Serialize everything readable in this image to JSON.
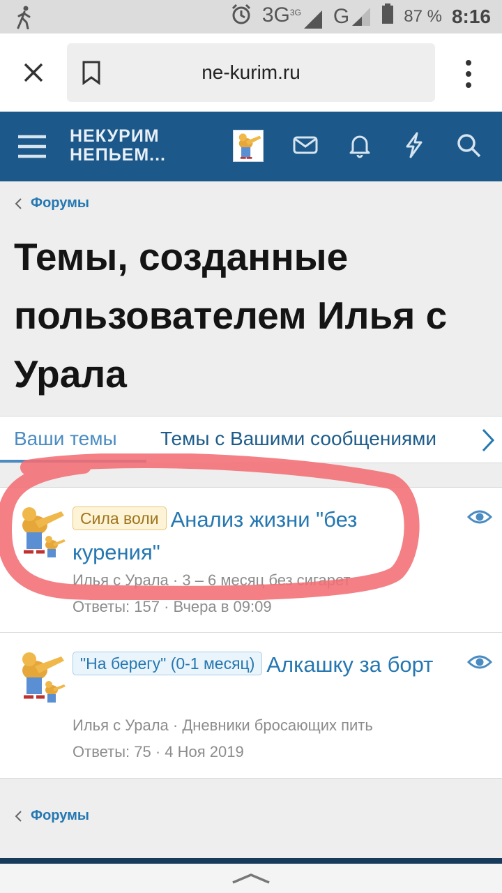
{
  "status_bar": {
    "network1": "3G",
    "network1_sup": "3G",
    "network2": "G",
    "battery": "87 %",
    "time": "8:16"
  },
  "browser": {
    "url": "ne-kurim.ru"
  },
  "site": {
    "logo_line1": "НЕКУРИМ",
    "logo_line2": "НЕПЬЕМ..."
  },
  "breadcrumb": {
    "label": "Форумы"
  },
  "page_title": "Темы, созданные пользователем Илья с Урала",
  "tabs": [
    {
      "label": "Ваши темы",
      "active": true
    },
    {
      "label": "Темы с Вашими сообщениями",
      "active": false
    }
  ],
  "threads": [
    {
      "prefix": "Сила воли",
      "prefix_style": "gold",
      "title": "Анализ жизни \"без курения\"",
      "author": "Илья с Урала",
      "forum": "3 – 6 месяц без сигарет",
      "replies_label": "Ответы: 157",
      "last_post": "Вчера в 09:09"
    },
    {
      "prefix": "\"На берегу\" (0-1 месяц)",
      "prefix_style": "blue",
      "title": "Алкашку за борт",
      "author": "Илья с Урала",
      "forum": "Дневники бросающих пить",
      "replies_label": "Ответы: 75",
      "last_post": "4 Ноя 2019"
    }
  ],
  "footer_breadcrumb": {
    "label": "Форумы"
  },
  "colors": {
    "header_bg": "#1c5889",
    "link": "#2577b1",
    "annotation": "#f26d73"
  }
}
